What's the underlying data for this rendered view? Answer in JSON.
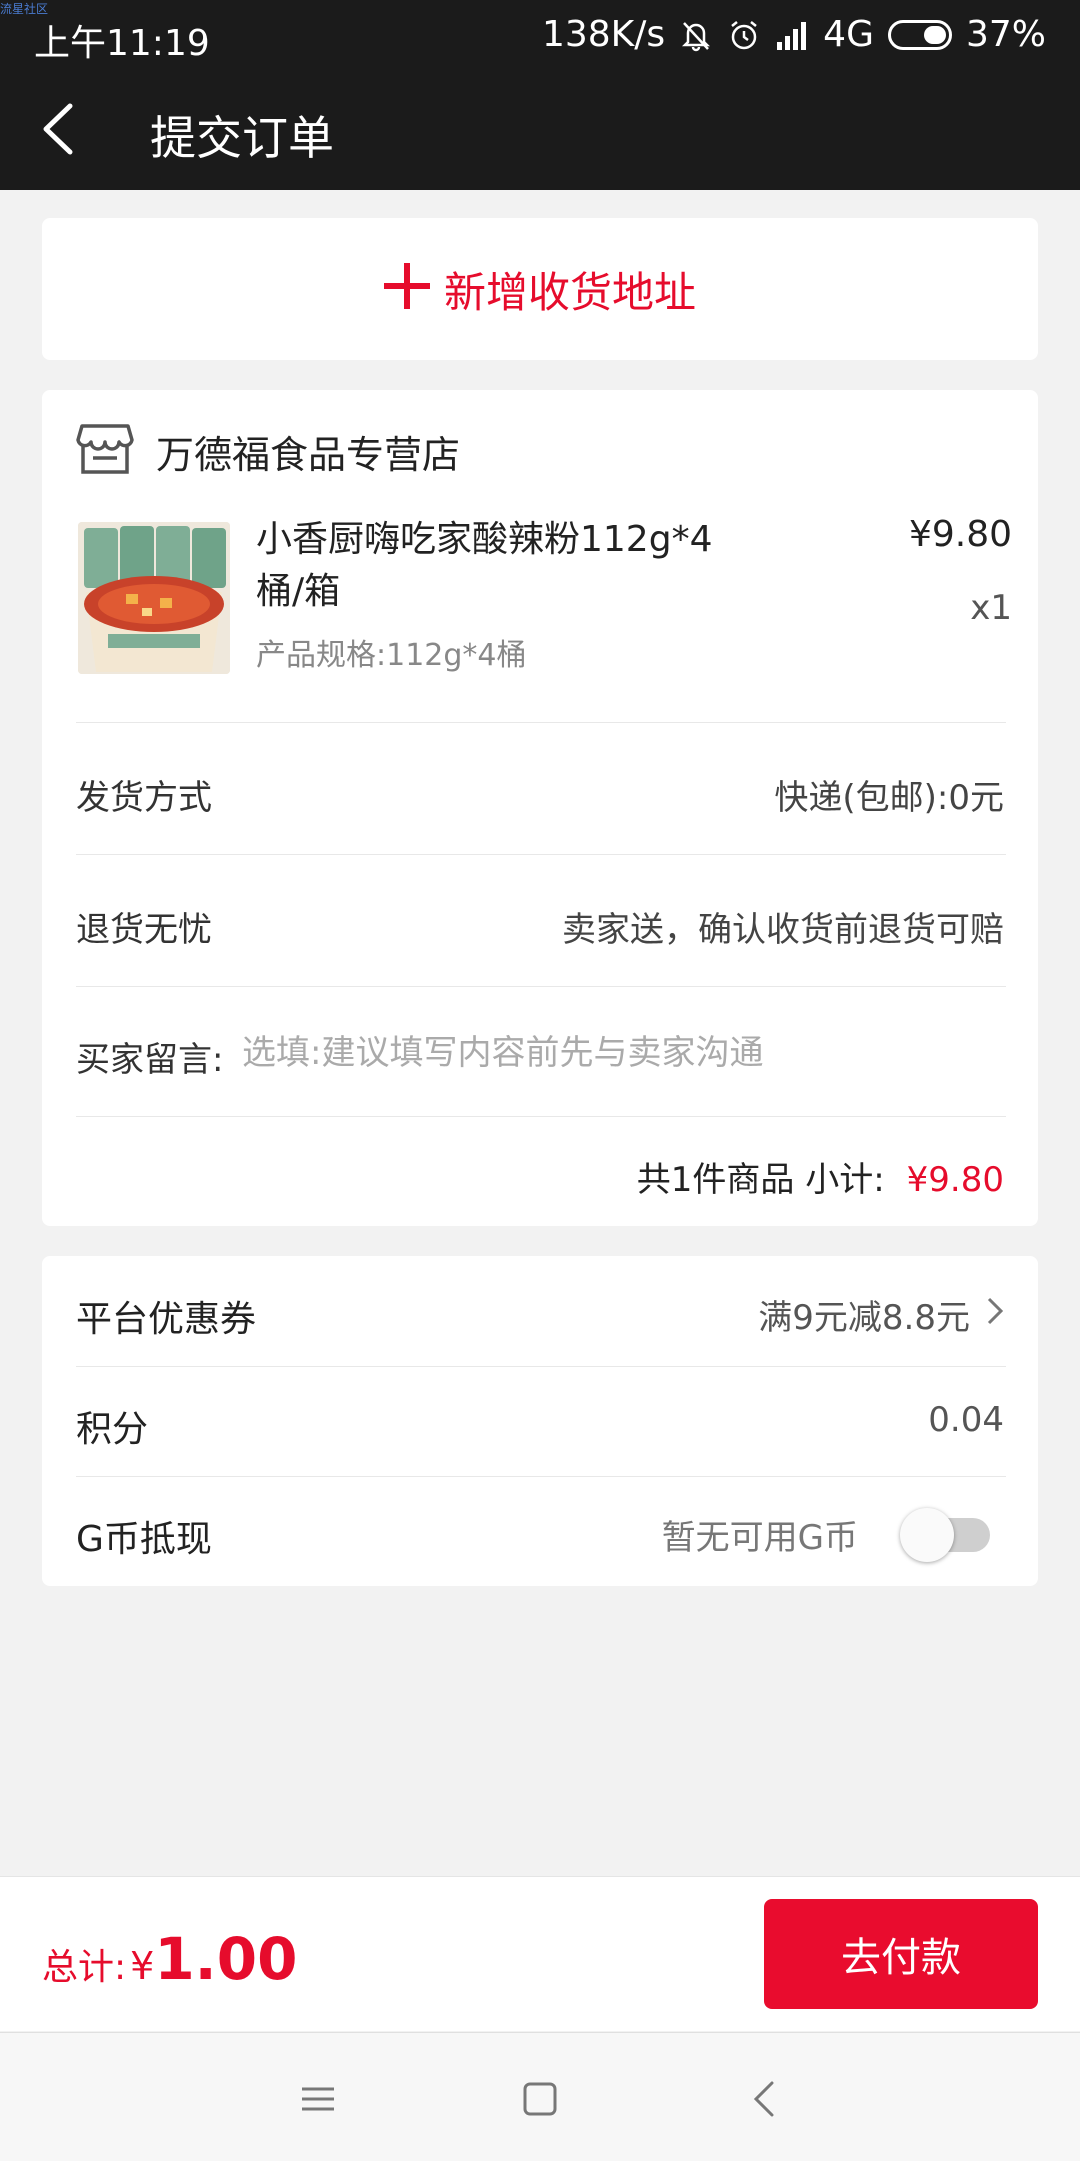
{
  "status_bar": {
    "watermark": "流星社区",
    "time": "上午11:19",
    "speed": "138K/s",
    "network": "4G",
    "battery": "37%",
    "icons": [
      "mute-bell-icon",
      "alarm-icon",
      "signal-icon",
      "battery-icon"
    ]
  },
  "header": {
    "title": "提交订单",
    "back_icon": "back-arrow-icon"
  },
  "address": {
    "add_label": "新增收货地址",
    "icon": "plus-icon"
  },
  "order": {
    "store_name": "万德福食品专营店",
    "store_icon": "store-icon",
    "product": {
      "title": "小香厨嗨吃家酸辣粉112g*4桶/箱",
      "spec": "产品规格:112g*4桶",
      "price": "¥9.80",
      "quantity": "x1"
    },
    "shipping": {
      "label": "发货方式",
      "value": "快递(包邮):0元"
    },
    "returns": {
      "label": "退货无忧",
      "value": "卖家送，确认收货前退货可赔"
    },
    "message": {
      "label": "买家留言:",
      "placeholder": "选填:建议填写内容前先与卖家沟通",
      "value": ""
    },
    "subtotal": {
      "label": "共1件商品 小计:",
      "amount": "¥9.80"
    }
  },
  "benefits": {
    "coupon": {
      "label": "平台优惠券",
      "value": "满9元减8.8元"
    },
    "points": {
      "label": "积分",
      "value": "0.04"
    },
    "gcoin": {
      "label": "G币抵现",
      "hint": "暂无可用G币",
      "enabled": false
    }
  },
  "footer": {
    "total_label": "总计:",
    "currency": "¥",
    "total_amount": "1.00",
    "pay_label": "去付款"
  },
  "nav_bar": {
    "icons": [
      "menu-icon",
      "home-icon",
      "back-icon"
    ]
  },
  "colors": {
    "accent": "#e60c2c",
    "header_bg": "#1b1b1b",
    "page_bg": "#f2f2f2"
  }
}
